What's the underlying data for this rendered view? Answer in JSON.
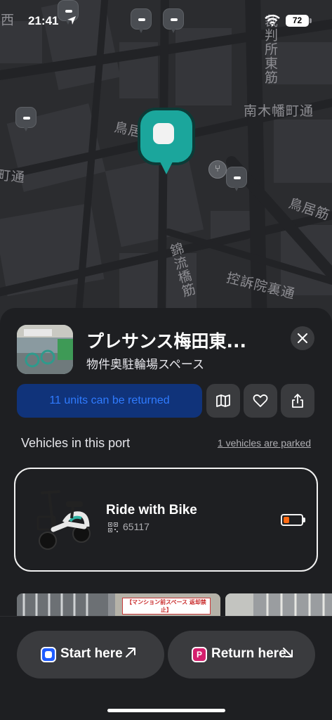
{
  "status_bar": {
    "time": "21:41",
    "battery_percent": "72"
  },
  "map": {
    "street_labels": {
      "nishi_fragment": "西",
      "saibansho_higashi": "裁判所東筋",
      "minami_kihata": "南木幡町通",
      "tori_fragment": "鳥居",
      "machi_dori_fragment": "町通",
      "tori_ii": "鳥居筋",
      "hiratsuka": "控訴院裏通",
      "bankai": "錦流橋筋"
    }
  },
  "port": {
    "title": "プレサンス梅田東...",
    "subtitle": "物件奥駐輪場スペース",
    "return_status": "11 units can be returned"
  },
  "vehicles": {
    "heading": "Vehicles in this port",
    "parked_link": "1 vehicles are parked",
    "items": [
      {
        "name": "Ride with Bike",
        "id": "65117",
        "battery_fraction": 0.35
      }
    ]
  },
  "photos": {
    "sign_text": "【マンション前スペース 返却禁止】"
  },
  "actions": {
    "start_label": "Start here",
    "return_label": "Return here",
    "return_badge_letter": "P"
  },
  "colors": {
    "accent_teal": "#1ba69c",
    "return_badge_bg": "#10337a",
    "return_badge_text": "#2f7bff",
    "start_badge": "#1f5cff",
    "return_badge": "#d41f6d",
    "battery_low": "#ff6a13"
  }
}
